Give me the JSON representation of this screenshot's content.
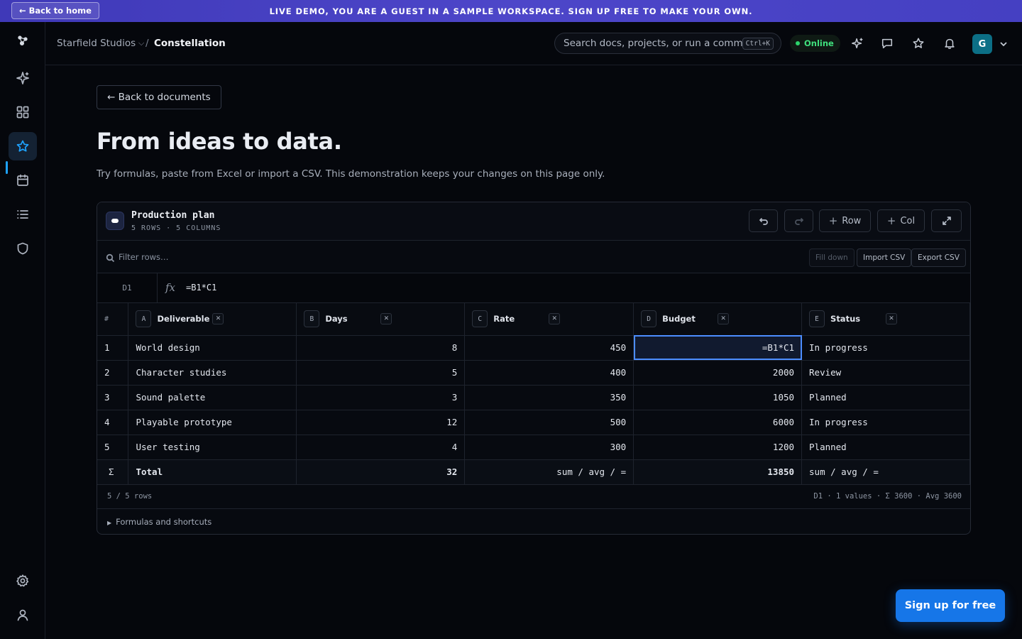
{
  "banner": {
    "back_label": "← Back to home",
    "text": "LIVE DEMO, YOU ARE A GUEST IN A SAMPLE WORKSPACE. SIGN UP FREE TO MAKE YOUR OWN."
  },
  "rail": {
    "items": [
      "logo-icon",
      "sparkle-icon",
      "grid-icon",
      "star-icon",
      "calendar-icon",
      "list-icon",
      "shield-icon",
      "gear-icon",
      "user-icon"
    ],
    "active": "star-icon"
  },
  "topbar": {
    "org": "Starfield Studios",
    "separator": "/",
    "page": "Constellation",
    "search_placeholder": "Search docs, projects, or run a command",
    "search_shortcut": "Ctrl+K",
    "status": "Online",
    "avatar_initial": "G"
  },
  "main": {
    "back_label": "← Back to documents",
    "title": "From ideas to data.",
    "subtitle": "Try formulas, paste from Excel or import a CSV. This demonstration keeps your changes on this page only."
  },
  "sheet": {
    "title": "Production plan",
    "meta": "5 ROWS · 5 COLUMNS",
    "row_button": "Row",
    "col_button": "Col",
    "filter_placeholder": "Filter rows…",
    "fill_down": "Fill down",
    "import_csv": "Import CSV",
    "export_csv": "Export CSV",
    "cell_ref": "D1",
    "fx": "fx",
    "formula": "=B1*C1",
    "hash": "#",
    "columns": [
      {
        "letter": "A",
        "name": "Deliverable"
      },
      {
        "letter": "B",
        "name": "Days"
      },
      {
        "letter": "C",
        "name": "Rate"
      },
      {
        "letter": "D",
        "name": "Budget"
      },
      {
        "letter": "E",
        "name": "Status"
      }
    ],
    "rows": [
      {
        "n": "1",
        "deliverable": "World design",
        "days": "8",
        "rate": "450",
        "budget": "=B1*C1",
        "status": "In progress"
      },
      {
        "n": "2",
        "deliverable": "Character studies",
        "days": "5",
        "rate": "400",
        "budget": "2000",
        "status": "Review"
      },
      {
        "n": "3",
        "deliverable": "Sound palette",
        "days": "3",
        "rate": "350",
        "budget": "1050",
        "status": "Planned"
      },
      {
        "n": "4",
        "deliverable": "Playable prototype",
        "days": "12",
        "rate": "500",
        "budget": "6000",
        "status": "In progress"
      },
      {
        "n": "5",
        "deliverable": "User testing",
        "days": "4",
        "rate": "300",
        "budget": "1200",
        "status": "Planned"
      }
    ],
    "total": {
      "sigma": "Σ",
      "label": "Total",
      "days": "32",
      "rate": "sum / avg / =",
      "budget": "13850",
      "status": "sum / avg / ="
    },
    "row_count": "5 / 5 rows",
    "selection_summary": "D1 · 1 values · Σ 3600 · Avg 3600",
    "shortcuts_label": "Formulas and shortcuts"
  },
  "cta": {
    "signup": "Sign up for free"
  },
  "colors": {
    "accent": "#1676e8",
    "banner": "#4540c2",
    "online": "#2bd46b",
    "selection": "#4c8dff"
  }
}
